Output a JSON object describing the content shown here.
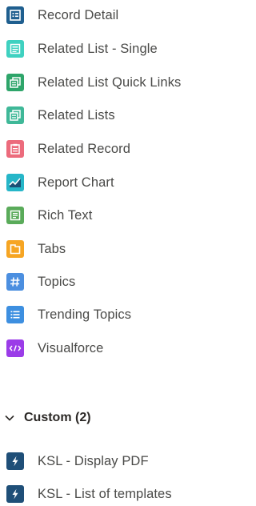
{
  "components": [
    {
      "label": "Record Detail",
      "icon": "record-detail-icon",
      "color": "#1f5f8f"
    },
    {
      "label": "Related List - Single",
      "icon": "related-list-single-icon",
      "color": "#3fd1c0"
    },
    {
      "label": "Related List Quick Links",
      "icon": "related-list-quick-links-icon",
      "color": "#2ea56a"
    },
    {
      "label": "Related Lists",
      "icon": "related-lists-icon",
      "color": "#3fb898"
    },
    {
      "label": "Related Record",
      "icon": "related-record-icon",
      "color": "#ec6b7c"
    },
    {
      "label": "Report Chart",
      "icon": "report-chart-icon",
      "color": "#26b6c8"
    },
    {
      "label": "Rich Text",
      "icon": "rich-text-icon",
      "color": "#5aab5a"
    },
    {
      "label": "Tabs",
      "icon": "tabs-icon",
      "color": "#f6a523"
    },
    {
      "label": "Topics",
      "icon": "topics-icon",
      "color": "#4c8fe0"
    },
    {
      "label": "Trending Topics",
      "icon": "trending-topics-icon",
      "color": "#3d8fe0"
    },
    {
      "label": "Visualforce",
      "icon": "visualforce-icon",
      "color": "#9b3ce8"
    }
  ],
  "custom_section": {
    "header_label": "Custom (2)",
    "expanded": true,
    "items": [
      {
        "label": "KSL - Display PDF",
        "icon": "lightning-bolt-icon",
        "color": "#1f4f78"
      },
      {
        "label": "KSL - List of templates",
        "icon": "lightning-bolt-icon",
        "color": "#1f4f78"
      }
    ]
  }
}
